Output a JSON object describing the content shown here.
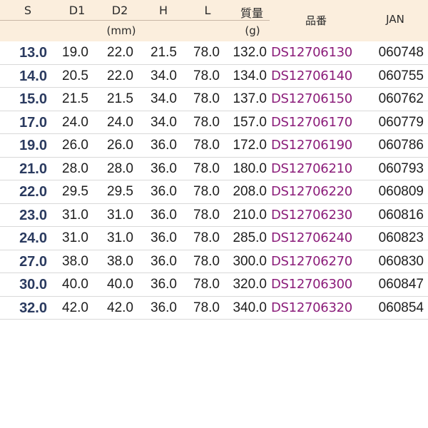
{
  "colors": {
    "header_bg": "#fbeedd",
    "size_text": "#2a3a5f",
    "part_number_text": "#8b1d7a",
    "row_divider": "#d9d9d9"
  },
  "headers": {
    "s": "S",
    "d1": "D1",
    "d2": "D2",
    "h": "H",
    "l": "L",
    "weight": "質量",
    "part_number": "品番",
    "jan": "JAN",
    "unit_mm": "(mm)",
    "unit_g": "(g)"
  },
  "rows": [
    {
      "s": "13.0",
      "d1": "19.0",
      "d2": "22.0",
      "h": "21.5",
      "l": "78.0",
      "weight": "132.0",
      "part_number": "DS12706130",
      "jan": "060748"
    },
    {
      "s": "14.0",
      "d1": "20.5",
      "d2": "22.0",
      "h": "34.0",
      "l": "78.0",
      "weight": "134.0",
      "part_number": "DS12706140",
      "jan": "060755"
    },
    {
      "s": "15.0",
      "d1": "21.5",
      "d2": "21.5",
      "h": "34.0",
      "l": "78.0",
      "weight": "137.0",
      "part_number": "DS12706150",
      "jan": "060762"
    },
    {
      "s": "17.0",
      "d1": "24.0",
      "d2": "24.0",
      "h": "34.0",
      "l": "78.0",
      "weight": "157.0",
      "part_number": "DS12706170",
      "jan": "060779"
    },
    {
      "s": "19.0",
      "d1": "26.0",
      "d2": "26.0",
      "h": "36.0",
      "l": "78.0",
      "weight": "172.0",
      "part_number": "DS12706190",
      "jan": "060786"
    },
    {
      "s": "21.0",
      "d1": "28.0",
      "d2": "28.0",
      "h": "36.0",
      "l": "78.0",
      "weight": "180.0",
      "part_number": "DS12706210",
      "jan": "060793"
    },
    {
      "s": "22.0",
      "d1": "29.5",
      "d2": "29.5",
      "h": "36.0",
      "l": "78.0",
      "weight": "208.0",
      "part_number": "DS12706220",
      "jan": "060809"
    },
    {
      "s": "23.0",
      "d1": "31.0",
      "d2": "31.0",
      "h": "36.0",
      "l": "78.0",
      "weight": "210.0",
      "part_number": "DS12706230",
      "jan": "060816"
    },
    {
      "s": "24.0",
      "d1": "31.0",
      "d2": "31.0",
      "h": "36.0",
      "l": "78.0",
      "weight": "285.0",
      "part_number": "DS12706240",
      "jan": "060823"
    },
    {
      "s": "27.0",
      "d1": "38.0",
      "d2": "38.0",
      "h": "36.0",
      "l": "78.0",
      "weight": "300.0",
      "part_number": "DS12706270",
      "jan": "060830"
    },
    {
      "s": "30.0",
      "d1": "40.0",
      "d2": "40.0",
      "h": "36.0",
      "l": "78.0",
      "weight": "320.0",
      "part_number": "DS12706300",
      "jan": "060847"
    },
    {
      "s": "32.0",
      "d1": "42.0",
      "d2": "42.0",
      "h": "36.0",
      "l": "78.0",
      "weight": "340.0",
      "part_number": "DS12706320",
      "jan": "060854"
    }
  ]
}
